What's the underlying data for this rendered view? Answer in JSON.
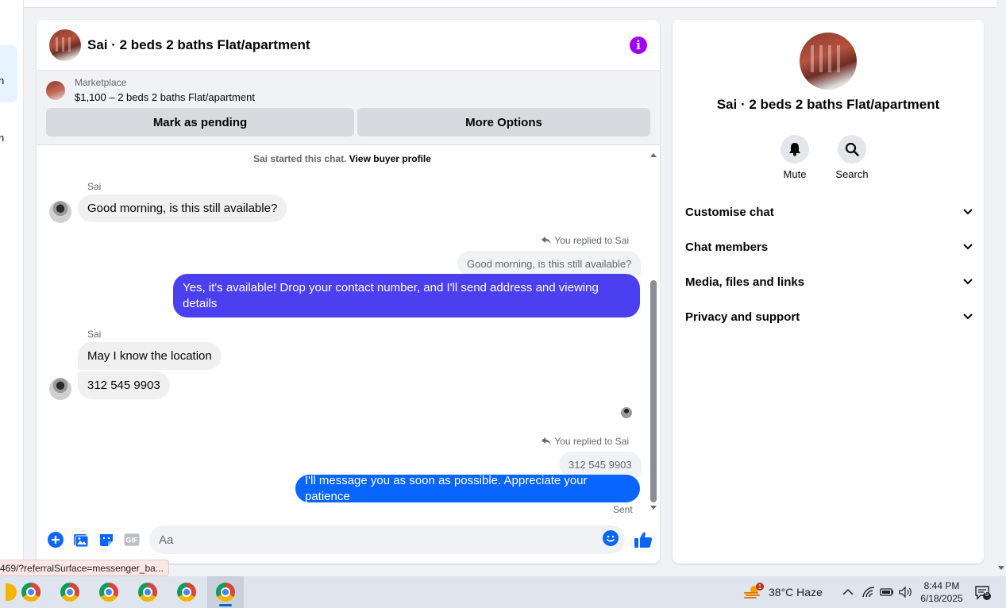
{
  "chat": {
    "title": "Sai · 2 beds 2 baths Flat/apartment",
    "marketplace": {
      "label": "Marketplace",
      "listing": "$1,100 – 2 beds 2 baths Flat/apartment",
      "pending_button": "Mark as pending",
      "options_button": "More Options"
    },
    "system_note": "Sai started this chat.",
    "system_link": "View buyer profile",
    "messages": {
      "m1_sender": "Sai",
      "m1_text": "Good morning, is this still available?",
      "r1_tag": "You replied to Sai",
      "r1_quote": "Good morning, is this still available?",
      "r1_text": "Yes, it's available! Drop your contact number, and I'll send address and viewing details",
      "m2_sender": "Sai",
      "m2_text": "May I know the location",
      "m3_text": "312 545 9903",
      "r2_tag": "You replied to Sai",
      "r2_quote": "312 545 9903",
      "r2_text": "I'll message you as soon as possible. Appreciate your patience",
      "status": "Sent"
    },
    "composer": {
      "placeholder": "Aa"
    }
  },
  "sidebar": {
    "title": "Sai · 2 beds 2 baths Flat/apartment",
    "mute_label": "Mute",
    "search_label": "Search",
    "sections": [
      "Customise chat",
      "Chat members",
      "Media, files and links",
      "Privacy and support"
    ]
  },
  "status_url": "469/?referralSurface=messenger_ba...",
  "taskbar": {
    "weather_badge": "1",
    "weather": "38°C  Haze",
    "time": "8:44 PM",
    "date": "6/18/2025",
    "notif_count": "5"
  },
  "colors": {
    "accent_purple": "#4b3ff0",
    "accent_blue": "#0866ff",
    "info_icon": "#a100ff"
  }
}
